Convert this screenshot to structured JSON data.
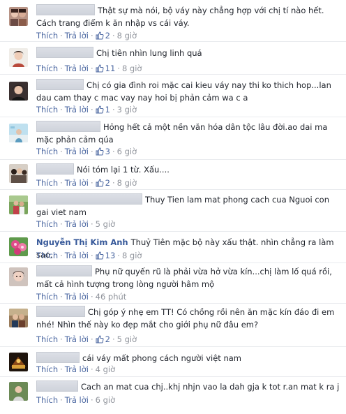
{
  "comments": [
    {
      "name": "",
      "text": "Thật sự mà nói, bộ váy này chẳng hợp với chị tí nào hết.\nCách trang điểm k ăn nhập vs cái váy.",
      "like": "Thích",
      "reply": "Trả lời",
      "likes": "2",
      "time": "8 giờ",
      "avatar": "avatar-two-people"
    },
    {
      "name": "",
      "text": "Chị tiên nhìn lung linh quá",
      "like": "Thích",
      "reply": "Trả lời",
      "likes": "11",
      "time": "8 giờ",
      "avatar": "avatar-woman"
    },
    {
      "name": "",
      "text": "Chị có gia đình roi mặc cai kieu váy nay thi ko thich hop...lan dau cam thay c mac vay nay hoi bị phản cảm wa c a",
      "like": "Thích",
      "reply": "Trả lời",
      "likes": "1",
      "time": "3 giờ",
      "avatar": "avatar-woman-dark"
    },
    {
      "name": "",
      "text": "Hỏng hết cả một nền văn hóa dân tộc lâu đời.ao dai ma mặc phản cảm qúa",
      "like": "Thích",
      "reply": "Trả lời",
      "likes": "3",
      "time": "6 giờ",
      "avatar": "avatar-landscape"
    },
    {
      "name": "",
      "text": "Nói tóm lại 1 từ. Xấu....",
      "like": "Thích",
      "reply": "Trả lời",
      "likes": "2",
      "time": "8 giờ",
      "avatar": "avatar-group"
    },
    {
      "name": "",
      "text": "Thuy Tien lam mat phong cach cua Nguoi con gai viet nam",
      "like": "Thích",
      "reply": "Trả lời",
      "likes": "",
      "time": "5 giờ",
      "avatar": "avatar-outdoor"
    },
    {
      "name": "Nguyễn Thị Kim Anh",
      "text": "Thuỷ Tiên mặc bộ này xấu thật. nhìn chẳng ra làm sao.",
      "like": "Thích",
      "reply": "Trả lời",
      "likes": "13",
      "time": "8 giờ",
      "avatar": "avatar-flowers"
    },
    {
      "name": "",
      "text": "Phụ nữ quyến rũ là phải vừa hở vừa kín...chị làm lố quá rồi, mất cả hình tượng trong lòng người hâm mộ",
      "like": "Thích",
      "reply": "Trả lời",
      "likes": "",
      "time": "46 phút",
      "avatar": "avatar-woman-face"
    },
    {
      "name": "",
      "text": "Chị góp ý nhẹ em TT! Có chồng rồi nên ăn mặc kín đáo đi em nhé! Nhìn thế này ko đẹp mắt cho giới phụ nữ đâu em?",
      "like": "Thích",
      "reply": "Trả lời",
      "likes": "2",
      "time": "5 giờ",
      "avatar": "avatar-couple"
    },
    {
      "name": "",
      "text": "cái váy mất phong cách người việt nam",
      "like": "Thích",
      "reply": "Trả lời",
      "likes": "",
      "time": "4 giờ",
      "avatar": "avatar-game"
    },
    {
      "name": "",
      "text": "Cach an mat cua chj..khj nhjn vao la dah gja k tot r.an mat k ra j",
      "like": "Thích",
      "reply": "Trả lời",
      "likes": "",
      "time": "6 giờ",
      "avatar": "avatar-child"
    }
  ],
  "colors": {
    "link": "#4b67a1",
    "name": "#365899",
    "meta": "#90949c",
    "text": "#1d2129",
    "divider": "#e9ebee"
  }
}
